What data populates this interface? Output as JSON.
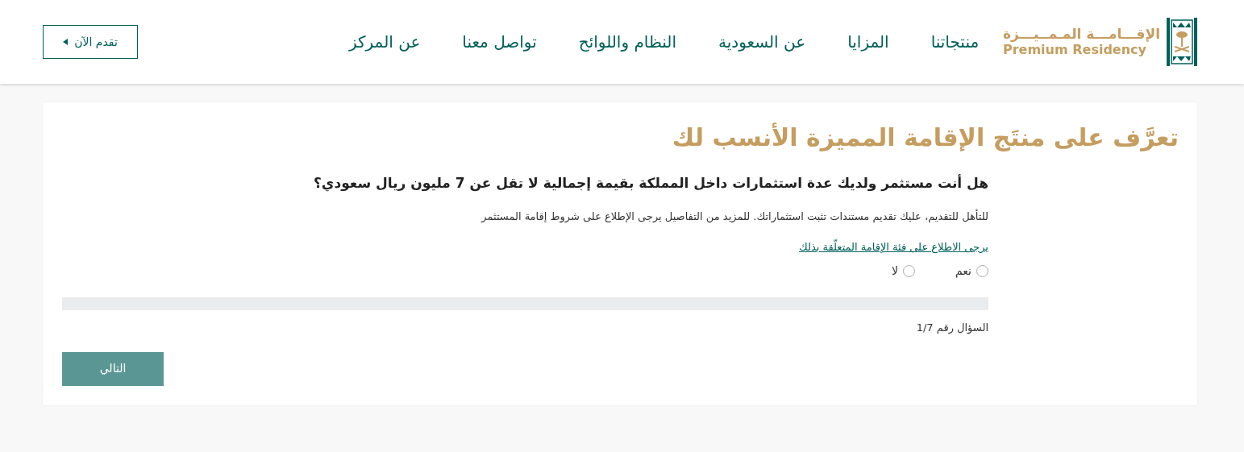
{
  "header": {
    "logo": {
      "arabic": "الإقـــامـــة المـمــيـــزة",
      "english": "Premium Residency"
    },
    "nav": [
      {
        "label": "منتجاتنا"
      },
      {
        "label": "المزايا"
      },
      {
        "label": "عن السعودية"
      },
      {
        "label": "النظام واللوائح"
      },
      {
        "label": "تواصل معنا"
      },
      {
        "label": "عن المركز"
      }
    ],
    "apply_button": {
      "label": "تقدم الآن"
    }
  },
  "card": {
    "title": "تعرَّف على منتَج الإقامة المميزة الأنسب لك",
    "question": "هل أنت مستثمر ولديك عدة استثمارات داخل المملكة بقيمة إجمالية لا تقل عن 7 مليون ريال سعودي؟",
    "description": "للتأهل للتقديم، عليك تقديم مستندات تثبت استثماراتك. للمزيد من التفاصيل يرجى الإطلاع على شروط إقامة المستثمر",
    "link": "يرجى الاطلاع على فئة الإقامة المتعلّقة بذلك",
    "options": [
      {
        "label": "نعم",
        "selected": false
      },
      {
        "label": "لا",
        "selected": false
      }
    ],
    "progress": {
      "level": 0
    },
    "counter": "السؤال رقم 1/7",
    "next_button": "التالي"
  }
}
